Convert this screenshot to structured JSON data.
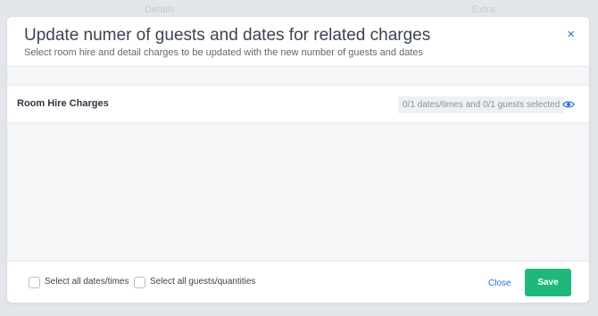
{
  "background": {
    "tabs": [
      "Details",
      "Extra"
    ]
  },
  "modal": {
    "title": "Update numer of guests and dates for related charges",
    "subtitle": "Select room hire and detail charges to be updated with the new number of guests and dates",
    "close_icon": "×"
  },
  "section": {
    "title": "Room Hire Charges",
    "selection_summary": "0/1 dates/times and 0/1 guests selected",
    "view_icon": "eye-icon"
  },
  "footer": {
    "select_all_dates_label": "Select all dates/times",
    "select_all_dates_checked": false,
    "select_all_guests_label": "Select all guests/quantities",
    "select_all_guests_checked": false,
    "close_label": "Close",
    "save_label": "Save"
  },
  "colors": {
    "accent": "#2f6fd6",
    "save": "#20b87a",
    "overlay": "#e3e6ea"
  }
}
